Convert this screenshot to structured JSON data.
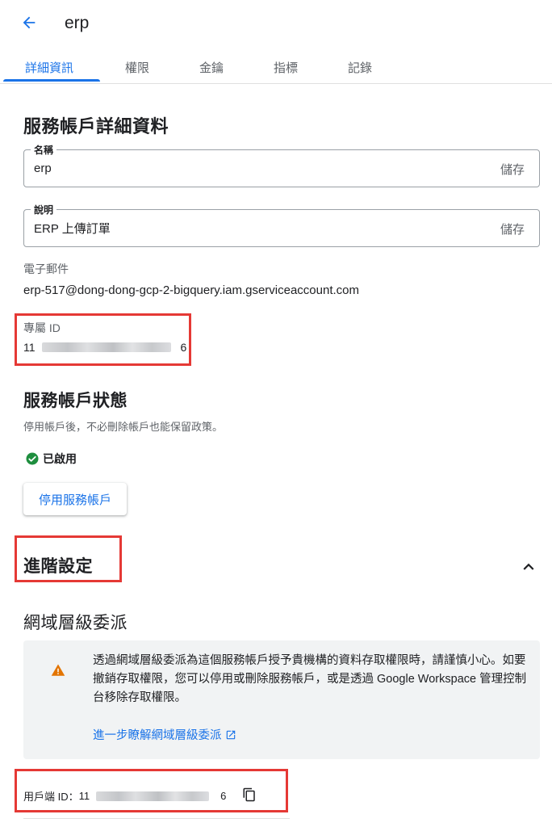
{
  "header": {
    "title": "erp"
  },
  "tabs": [
    {
      "label": "詳細資訊",
      "active": true
    },
    {
      "label": "權限"
    },
    {
      "label": "金鑰"
    },
    {
      "label": "指標"
    },
    {
      "label": "記錄"
    }
  ],
  "details": {
    "heading": "服務帳戶詳細資料",
    "name_field": {
      "label": "名稱",
      "value": "erp",
      "save_label": "儲存"
    },
    "description_field": {
      "label": "說明",
      "value": "ERP 上傳訂單",
      "save_label": "儲存"
    },
    "email_label": "電子郵件",
    "email_value": "erp-517@dong-dong-gcp-2-bigquery.iam.gserviceaccount.com",
    "unique_id_label": "專屬 ID",
    "unique_id_prefix": "11",
    "unique_id_suffix": "6"
  },
  "status_section": {
    "heading": "服務帳戶狀態",
    "description": "停用帳戶後，不必刪除帳戶也能保留政策。",
    "status_label": "已啟用",
    "disable_button": "停用服務帳戶"
  },
  "advanced": {
    "heading": "進階設定",
    "subheading": "網域層級委派",
    "warning_text": "透過網域層級委派為這個服務帳戶授予貴機構的資料存取權限時，請謹慎小心。如要撤銷存取權限，您可以停用或刪除服務帳戶，或是透過 Google Workspace 管理控制台移除存取權限。",
    "learn_more_link": "進一步瞭解網域層級委派",
    "client_id_label": "用戶端 ID：",
    "client_id_prefix": "11",
    "client_id_suffix": "6"
  },
  "colors": {
    "accent": "#1a73e8",
    "success": "#1e8e3e",
    "warning": "#e37400",
    "highlight_box": "#e53935"
  },
  "icons": {
    "back": "arrow-back-icon",
    "check": "check-circle-icon",
    "collapse": "chevron-up-icon",
    "warning": "warning-icon",
    "external": "open-in-new-icon",
    "copy": "copy-icon"
  }
}
